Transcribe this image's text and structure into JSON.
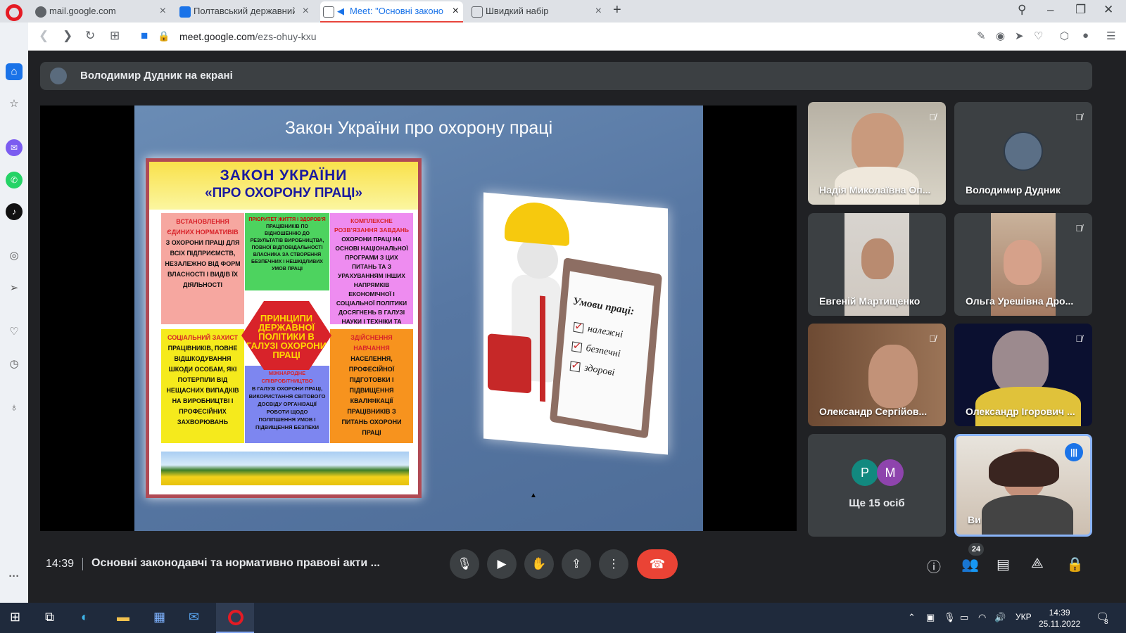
{
  "browser": {
    "tabs": [
      {
        "label": "mail.google.com",
        "icon": "google-icon",
        "active": false
      },
      {
        "label": "Полтавський державний а",
        "icon": "calendar-icon",
        "active": false
      },
      {
        "label": "Meet: \"Основні законо",
        "icon": "meet-icon",
        "active": true
      },
      {
        "label": "Швидкий набір",
        "icon": "speed-dial-icon",
        "active": false
      }
    ],
    "url_prefix": "meet.google.com",
    "url_path": "/ezs-ohuy-kxu"
  },
  "meet": {
    "presenter_text": "Володимир Дудник на екрані",
    "slide": {
      "title": "Закон України про охорону праці",
      "poster_title_1": "ЗАКОН УКРАЇНИ",
      "poster_title_2": "«ПРО ОХОРОНУ ПРАЦІ»",
      "center": "ПРИНЦИПИ ДЕРЖАВНОЇ ПОЛІТИКИ В ГАЛУЗІ ОХОРОНИ ПРАЦІ",
      "cells": [
        {
          "kw": "ВСТАНОВЛЕННЯ ЄДИНИХ НОРМАТИВІВ",
          "text": "З ОХОРОНИ ПРАЦІ ДЛЯ ВСІХ ПІДПРИЄМСТВ, НЕЗАЛЕЖНО ВІД ФОРМ ВЛАСНОСТІ І ВИДІВ ЇХ ДІЯЛЬНОСТІ"
        },
        {
          "kw": "ПРІОРИТЕТ ЖИТТЯ І ЗДОРОВ'Я",
          "text": "ПРАЦІВНИКІВ ПО ВІДНОШЕННЮ ДО РЕЗУЛЬТАТІВ ВИРОБНИЦТВА, ПОВНОЇ ВІДПОВІДАЛЬНОСТІ ВЛАСНИКА ЗА СТВОРЕННЯ БЕЗПЕЧНИХ І НЕШКІДЛИВИХ УМОВ ПРАЦІ"
        },
        {
          "kw": "КОМПЛЕКСНЕ РОЗВ'ЯЗАННЯ ЗАВДАНЬ",
          "text": "ОХОРОНИ ПРАЦІ НА ОСНОВІ НАЦІОНАЛЬНОЇ ПРОГРАМИ З ЦИХ ПИТАНЬ ТА З УРАХУВАННЯМ ІНШИХ НАПРЯМКІВ ЕКОНОМІЧНОЇ І СОЦІАЛЬНОЇ ПОЛІТИКИ ДОСЯГНЕНЬ В ГАЛУЗІ НАУКИ І ТЕХНІКИ ТА ОХОРОНИ НАВКОЛИШНЬОГО СЕРЕДОВИЩА"
        },
        {
          "kw": "СОЦІАЛЬНИЙ ЗАХИСТ",
          "text": "ПРАЦІВНИКІВ, ПОВНЕ ВІДШКОДУВАННЯ ШКОДИ ОСОБАМ, ЯКІ ПОТЕРПІЛИ ВІД НЕЩАСНИХ ВИПАДКІВ НА ВИРОБНИЦТВІ І ПРОФЕСІЙНИХ ЗАХВОРЮВАНЬ"
        },
        {
          "kw": "МІЖНАРОДНЕ СПІВРОБІТНИЦТВО",
          "text": "В ГАЛУЗІ ОХОРОНИ ПРАЦІ, ВИКОРИСТАННЯ СВІТОВОГО ДОСВІДУ ОРГАНІЗАЦІЇ РОБОТИ ЩОДО ПОЛІПШЕННЯ УМОВ І ПІДВИЩЕННЯ БЕЗПЕКИ"
        },
        {
          "kw": "ЗДІЙСНЕННЯ НАВЧАННЯ",
          "text": "НАСЕЛЕННЯ, ПРОФЕСІЙНОЇ ПІДГОТОВКИ І ПІДВИЩЕННЯ КВАЛІФІКАЦІЇ ПРАЦІВНИКІВ З ПИТАНЬ ОХОРОНИ ПРАЦІ"
        }
      ],
      "clipboard_title": "Умови праці:",
      "clipboard_items": [
        "належні",
        "безпечні",
        "здорові"
      ]
    },
    "participants": [
      {
        "name": "Надія Миколаївна Оп...",
        "muted": true
      },
      {
        "name": "Володимир Дудник",
        "muted": true
      },
      {
        "name": "Евгеній Мартищенко",
        "muted": false
      },
      {
        "name": "Ольга Урешівна Дро...",
        "muted": true
      },
      {
        "name": "Олександр Сергійов...",
        "muted": true
      },
      {
        "name": "Олександр Ігорович ...",
        "muted": true
      }
    ],
    "others": {
      "avatar_1": "P",
      "avatar_2": "M",
      "label": "Ще 15 осіб"
    },
    "self_name": "Ви",
    "time": "14:39",
    "meeting_title": "Основні законодавчі та нормативно правові акти ...",
    "participant_count": "24"
  },
  "taskbar": {
    "language": "УКР",
    "time": "14:39",
    "date": "25.11.2022",
    "notifications": "8"
  },
  "colors": {
    "accent": "#1a73e8",
    "end_call": "#ea4335",
    "opera": "#e51b24"
  }
}
